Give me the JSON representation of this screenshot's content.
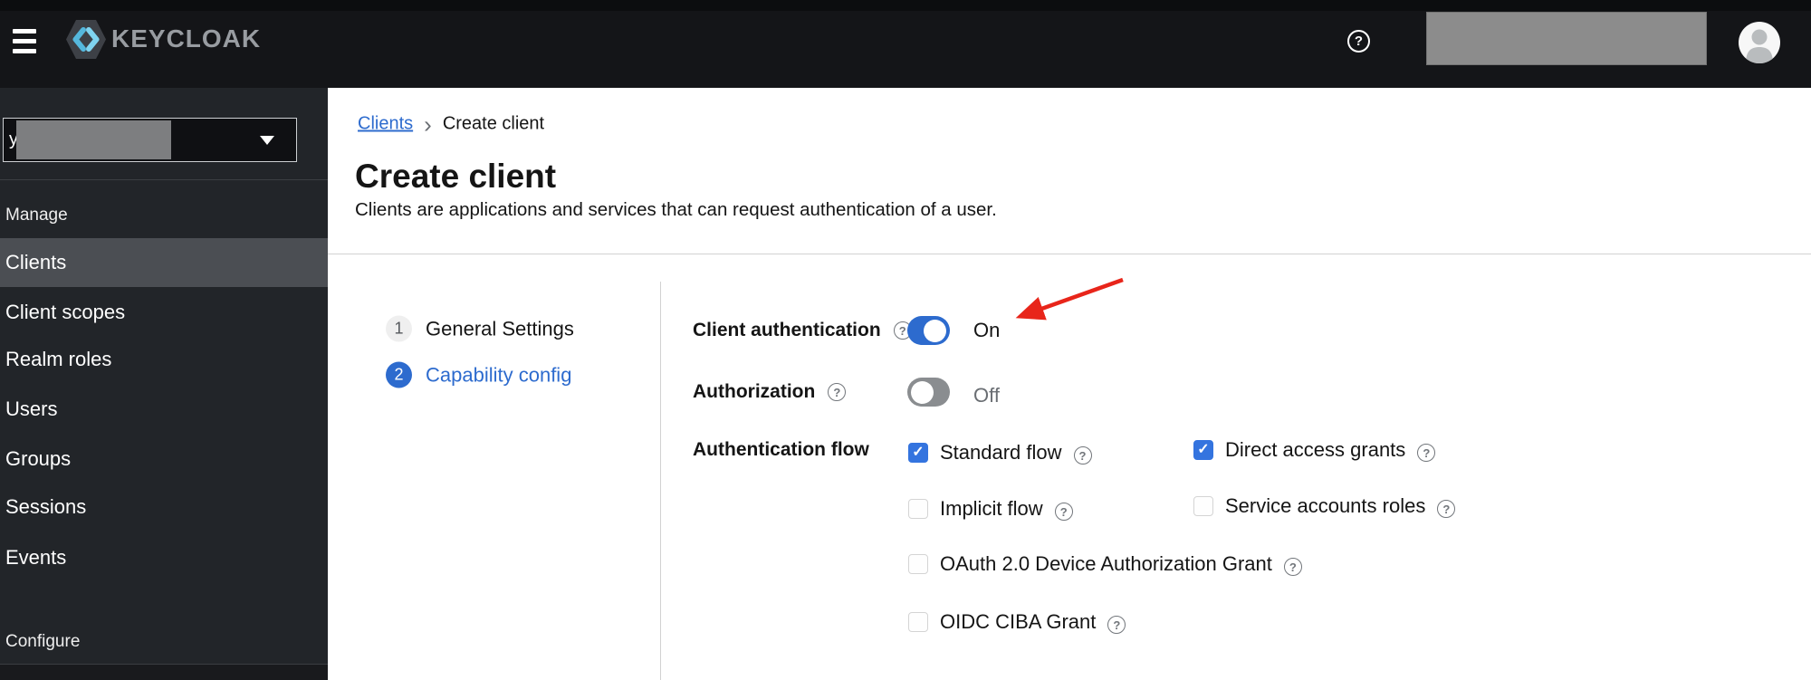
{
  "header": {
    "brand": "KEYCLOAK",
    "help_glyph": "?"
  },
  "sidebar": {
    "realm_fragment": "y",
    "manage_label": "Manage",
    "configure_label": "Configure",
    "items": [
      {
        "label": "Clients",
        "selected": true
      },
      {
        "label": "Client scopes",
        "selected": false
      },
      {
        "label": "Realm roles",
        "selected": false
      },
      {
        "label": "Users",
        "selected": false
      },
      {
        "label": "Groups",
        "selected": false
      },
      {
        "label": "Sessions",
        "selected": false
      },
      {
        "label": "Events",
        "selected": false
      }
    ]
  },
  "breadcrumb": {
    "parent": "Clients",
    "separator": "›",
    "current": "Create client"
  },
  "page": {
    "title": "Create client",
    "subtitle": "Clients are applications and services that can request authentication of a user."
  },
  "wizard": {
    "steps": [
      {
        "number": "1",
        "label": "General Settings",
        "active": false
      },
      {
        "number": "2",
        "label": "Capability config",
        "active": true
      }
    ]
  },
  "form": {
    "client_authentication": {
      "label": "Client authentication",
      "state": "On",
      "enabled": true
    },
    "authorization": {
      "label": "Authorization",
      "state": "Off",
      "enabled": false
    },
    "authentication_flow": {
      "label": "Authentication flow",
      "options": [
        {
          "label": "Standard flow",
          "checked": true
        },
        {
          "label": "Direct access grants",
          "checked": true
        },
        {
          "label": "Implicit flow",
          "checked": false
        },
        {
          "label": "Service accounts roles",
          "checked": false
        },
        {
          "label": "OAuth 2.0 Device Authorization Grant",
          "checked": false
        },
        {
          "label": "OIDC CIBA Grant",
          "checked": false
        }
      ]
    }
  },
  "colors": {
    "accent_blue": "#2d6bce",
    "checkbox_blue": "#3474df",
    "arrow_red": "#e8251a",
    "header_bg": "#141518",
    "sidebar_bg": "#222529",
    "selected_item_bg": "#4b4e53",
    "muted_gray": "#6a6e73"
  }
}
